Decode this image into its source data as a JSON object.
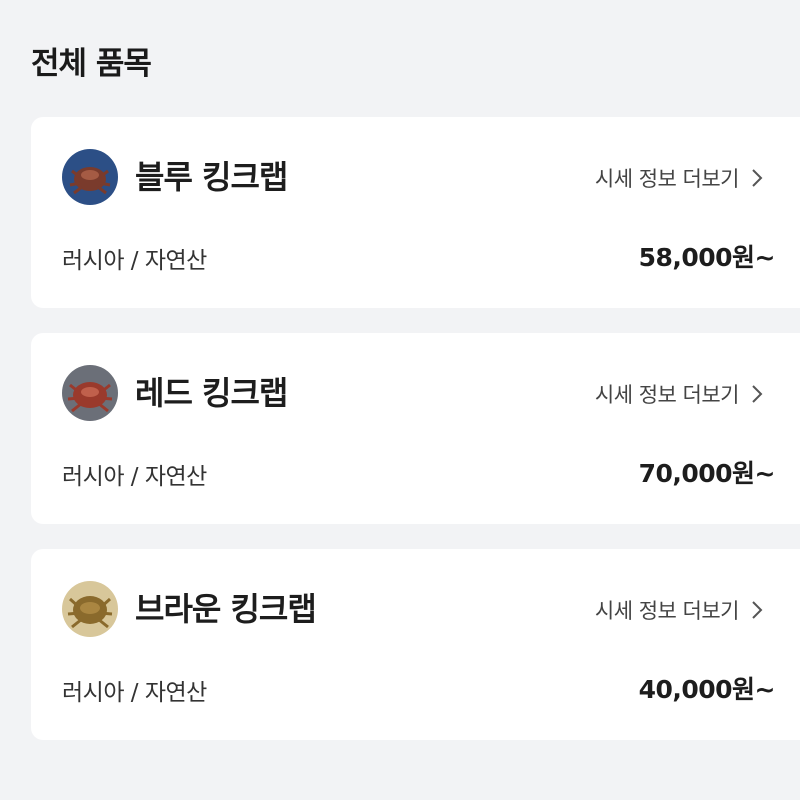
{
  "section": {
    "title": "전체 품목"
  },
  "items": [
    {
      "name": "블루 킹크랩",
      "more_label": "시세 정보 더보기",
      "origin": "러시아 / 자연산",
      "price": "58,000원~",
      "thumb_bg": "#2c4f86",
      "thumb_fg": "#7a3b2c"
    },
    {
      "name": "레드 킹크랩",
      "more_label": "시세 정보 더보기",
      "origin": "러시아 / 자연산",
      "price": "70,000원~",
      "thumb_bg": "#6b6f78",
      "thumb_fg": "#9a3a2c"
    },
    {
      "name": "브라운 킹크랩",
      "more_label": "시세 정보 더보기",
      "origin": "러시아 / 자연산",
      "price": "40,000원~",
      "thumb_bg": "#d8c79a",
      "thumb_fg": "#8a6a2c"
    }
  ]
}
